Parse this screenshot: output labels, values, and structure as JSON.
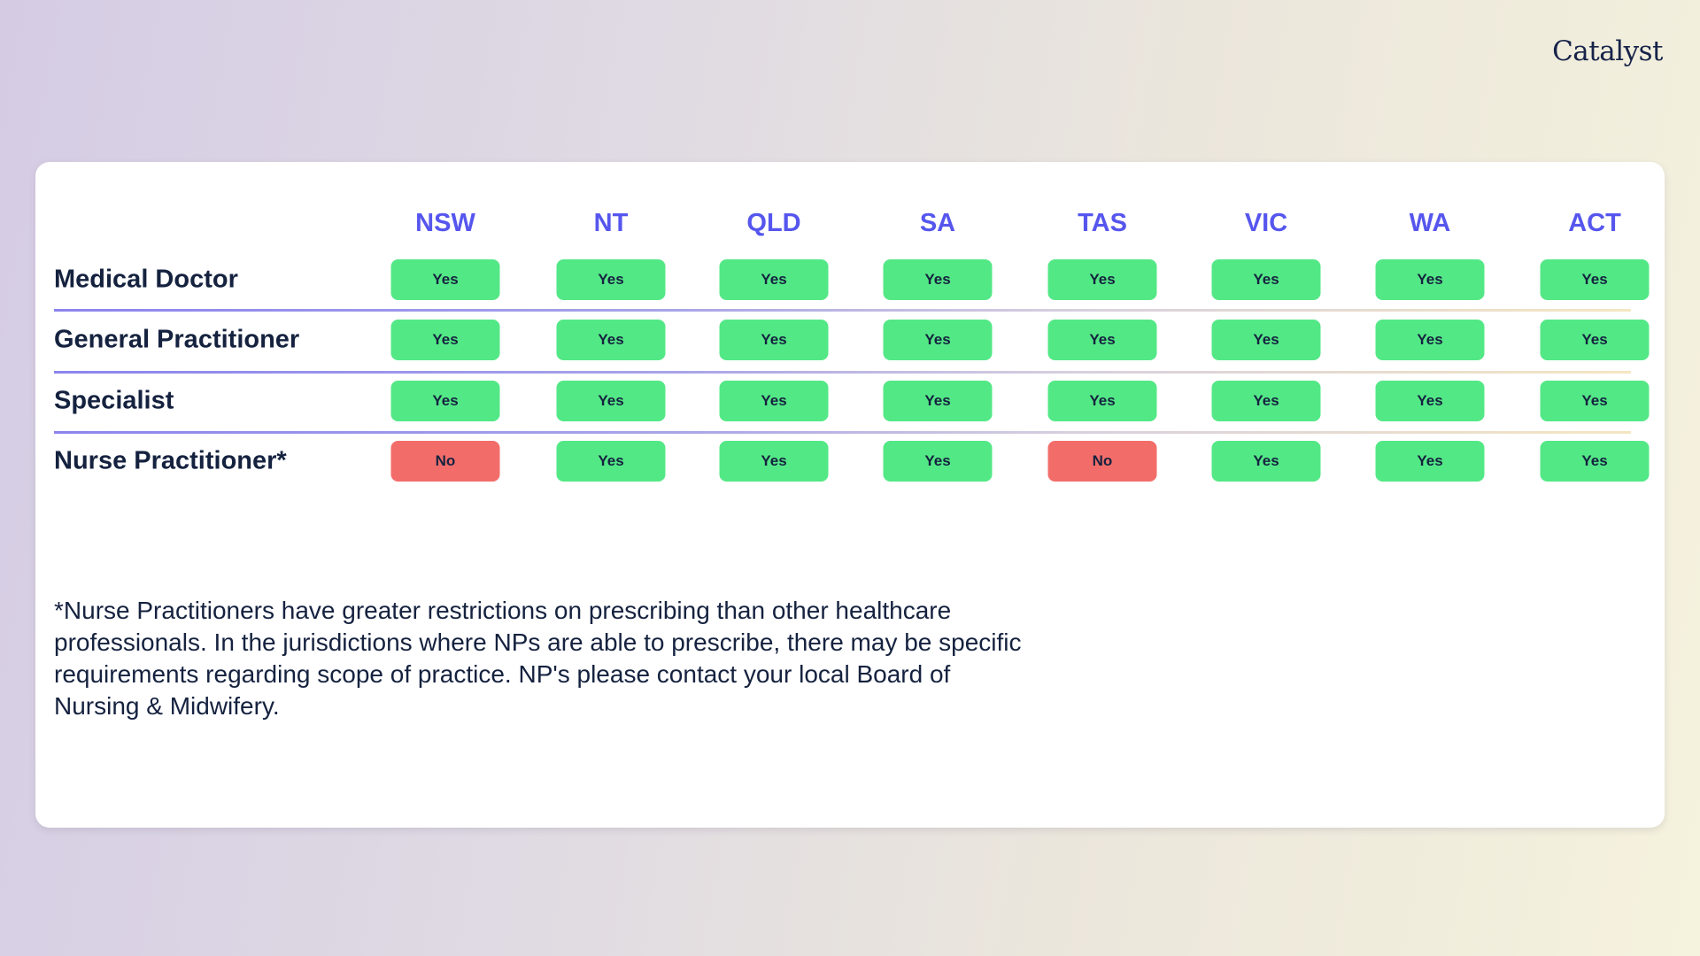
{
  "brand": "Catalyst",
  "table": {
    "columns": [
      "NSW",
      "NT",
      "QLD",
      "SA",
      "TAS",
      "VIC",
      "WA",
      "ACT"
    ],
    "rows": [
      {
        "label": "Medical Doctor",
        "values": [
          "Yes",
          "Yes",
          "Yes",
          "Yes",
          "Yes",
          "Yes",
          "Yes",
          "Yes"
        ]
      },
      {
        "label": "General Practitioner",
        "values": [
          "Yes",
          "Yes",
          "Yes",
          "Yes",
          "Yes",
          "Yes",
          "Yes",
          "Yes"
        ]
      },
      {
        "label": "Specialist",
        "values": [
          "Yes",
          "Yes",
          "Yes",
          "Yes",
          "Yes",
          "Yes",
          "Yes",
          "Yes"
        ]
      },
      {
        "label": "Nurse Practitioner*",
        "values": [
          "No",
          "Yes",
          "Yes",
          "Yes",
          "No",
          "Yes",
          "Yes",
          "Yes"
        ]
      }
    ]
  },
  "colors": {
    "yes": "#53e886",
    "no": "#f26d6a",
    "header": "#5656ee",
    "text": "#15223f"
  },
  "footnote": "*Nurse Practitioners have greater restrictions on prescribing than other healthcare professionals. In the jurisdictions where NPs are able to prescribe, there may be specific requirements regarding scope of practice. NP's please contact your local Board of Nursing & Midwifery."
}
